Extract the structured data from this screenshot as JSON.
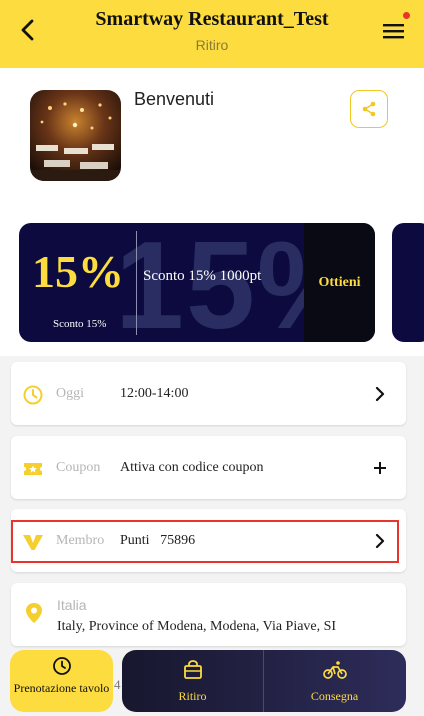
{
  "header": {
    "title": "Smartway Restaurant_Test",
    "subtitle": "Ritiro"
  },
  "profile": {
    "welcome": "Benvenuti"
  },
  "promo": {
    "big_text": "15%",
    "background_text": "15%",
    "small_text": "Sconto 15%",
    "description": "Sconto 15% 1000pt",
    "action_label": "Ottieni"
  },
  "rows": [
    {
      "label": "Oggi",
      "value": "12:00-14:00",
      "icon": "clock-icon",
      "action": "chevron-right-icon"
    },
    {
      "label": "Coupon",
      "value": "Attiva con codice coupon",
      "icon": "ticket-icon",
      "action": "plus-icon"
    },
    {
      "label": "Membro",
      "value": "Punti   75896",
      "icon": "member-v-icon",
      "action": "chevron-right-icon"
    }
  ],
  "address": {
    "city": "Italia",
    "line": "Italy, Province of Modena, Modena, Via Piave, SI"
  },
  "bottom_nav": {
    "left_label": "Prenotazione tavolo",
    "tabs": [
      "Ritiro",
      "Consegna"
    ],
    "peek_text": "4"
  },
  "colors": {
    "accent": "#fcdc3f",
    "promo_bg": "#0c0a3e",
    "highlight": "#e8342c"
  }
}
